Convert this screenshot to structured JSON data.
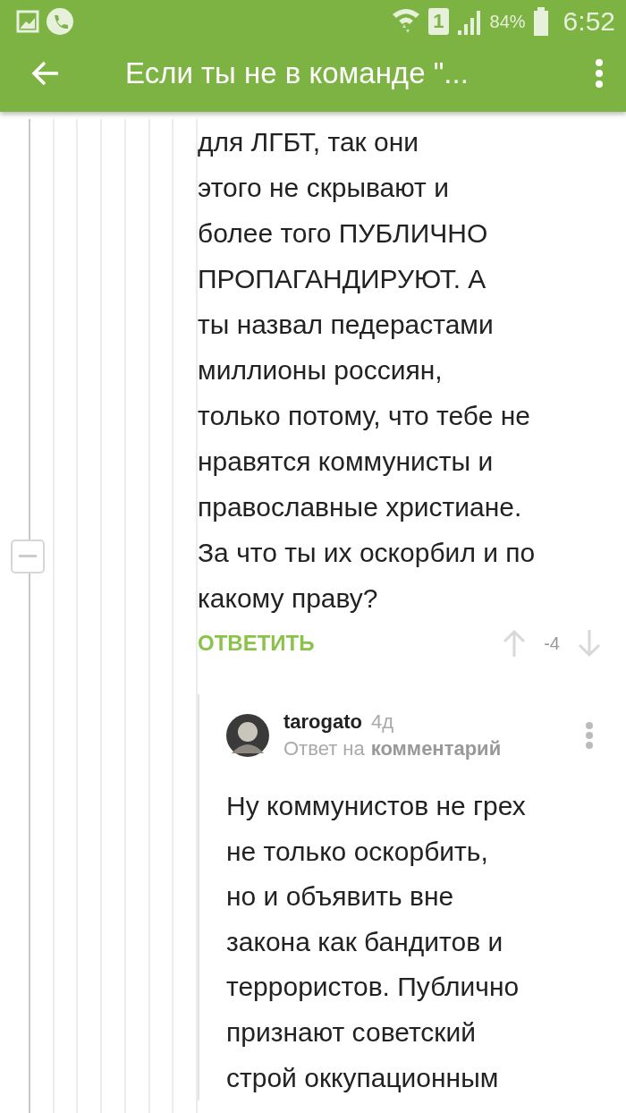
{
  "status_bar": {
    "battery": "84%",
    "time": "6:52",
    "sim": "1"
  },
  "app_bar": {
    "title": "Если ты не в команде \"..."
  },
  "comment": {
    "lines": [
      "для ЛГБТ, так они",
      "этого не скрывают и",
      "более того ПУБЛИЧНО",
      "ПРОПАГАНДИРУЮТ. А",
      "ты назвал педерастами",
      "миллионы россиян,",
      "только потому, что тебе не",
      "нравятся коммунисты и",
      "православные христиане.",
      "За что ты их оскорбил и по",
      "какому праву?"
    ],
    "reply_label": "ОТВЕТИТЬ",
    "rating": "-4",
    "expanded": true
  },
  "reply": {
    "author": "tarogato",
    "age": "4д",
    "reply_to_prefix": "Ответ на",
    "reply_to_link": "комментарий",
    "lines": [
      "Ну коммунистов не грех",
      "не только оскорбить,",
      "но и объявить вне",
      "закона как бандитов и",
      "террористов. Публично",
      "признают советский",
      "строй оккупационным"
    ]
  }
}
